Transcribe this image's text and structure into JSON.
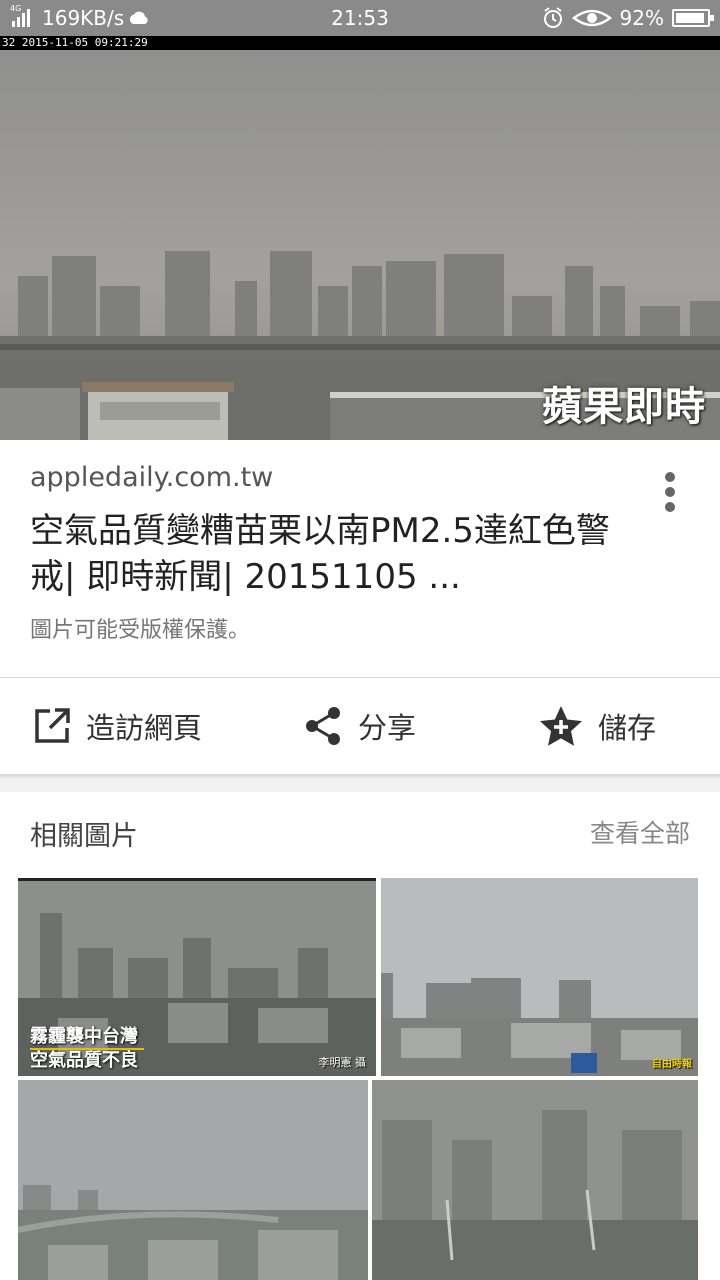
{
  "status_bar": {
    "network_type": "4G",
    "speed": "169KB/s",
    "time": "21:53",
    "battery_percent": "92%"
  },
  "hero_image": {
    "timestamp_overlay": "32 2015-11-05 09:21:29",
    "watermark": "蘋果即時"
  },
  "result": {
    "source": "appledaily.com.tw",
    "title": "空氣品質變糟苗栗以南PM2.5達紅色警戒| 即時新聞| 20151105 ...",
    "copyright_note": "圖片可能受版權保護。"
  },
  "actions": {
    "visit_label": "造訪網頁",
    "share_label": "分享",
    "save_label": "儲存"
  },
  "related": {
    "header": "相關圖片",
    "view_all": "查看全部",
    "thumb1_caption_line1": "霧霾襲中台灣",
    "thumb1_caption_line2": "空氣品質不良",
    "thumb1_credit": "李明憲 攝",
    "thumb2_badge": "自由時報"
  },
  "colors": {
    "status_bar_bg": "#8a8a8a",
    "text_primary": "#222222",
    "text_secondary": "#777777"
  }
}
